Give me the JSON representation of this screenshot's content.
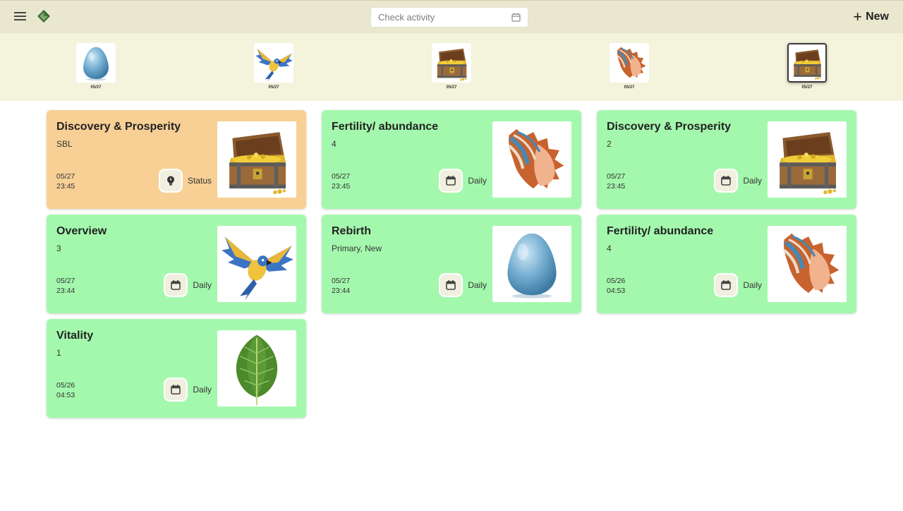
{
  "header": {
    "search_placeholder": "Check activity",
    "new_label": "New"
  },
  "strip": [
    {
      "icon": "egg-icon",
      "date": "05/27",
      "selected": false
    },
    {
      "icon": "parrot-icon",
      "date": "05/27",
      "selected": false
    },
    {
      "icon": "treasure-chest-icon",
      "date": "05/27",
      "selected": false
    },
    {
      "icon": "seashell-icon",
      "date": "05/27",
      "selected": false
    },
    {
      "icon": "treasure-chest-icon",
      "date": "05/27",
      "selected": true
    }
  ],
  "cards": [
    {
      "title": "Discovery & Prosperity",
      "subtitle": "SBL",
      "date": "05/27",
      "time": "23:45",
      "action": "Status",
      "action_icon": "lightbulb-icon",
      "image": "treasure-chest-icon",
      "color": "#f8d095"
    },
    {
      "title": "Fertility/ abundance",
      "subtitle": "4",
      "date": "05/27",
      "time": "23:45",
      "action": "Daily",
      "action_icon": "calendar-icon",
      "image": "seashell-icon",
      "color": "#a4f8ad"
    },
    {
      "title": "Discovery & Prosperity",
      "subtitle": "2",
      "date": "05/27",
      "time": "23:45",
      "action": "Daily",
      "action_icon": "calendar-icon",
      "image": "treasure-chest-icon",
      "color": "#a4f8ad"
    },
    {
      "title": "Overview",
      "subtitle": "3",
      "date": "05/27",
      "time": "23:44",
      "action": "Daily",
      "action_icon": "calendar-icon",
      "image": "parrot-icon",
      "color": "#a4f8ad"
    },
    {
      "title": "Rebirth",
      "subtitle": "Primary, New",
      "date": "05/27",
      "time": "23:44",
      "action": "Daily",
      "action_icon": "calendar-icon",
      "image": "egg-icon",
      "color": "#a4f8ad"
    },
    {
      "title": "Fertility/ abundance",
      "subtitle": "4",
      "date": "05/26",
      "time": "04:53",
      "action": "Daily",
      "action_icon": "calendar-icon",
      "image": "seashell-icon",
      "color": "#a4f8ad"
    },
    {
      "title": "Vitality",
      "subtitle": "1",
      "date": "05/26",
      "time": "04:53",
      "action": "Daily",
      "action_icon": "calendar-icon",
      "image": "leaf-icon",
      "color": "#a4f8ad"
    }
  ]
}
